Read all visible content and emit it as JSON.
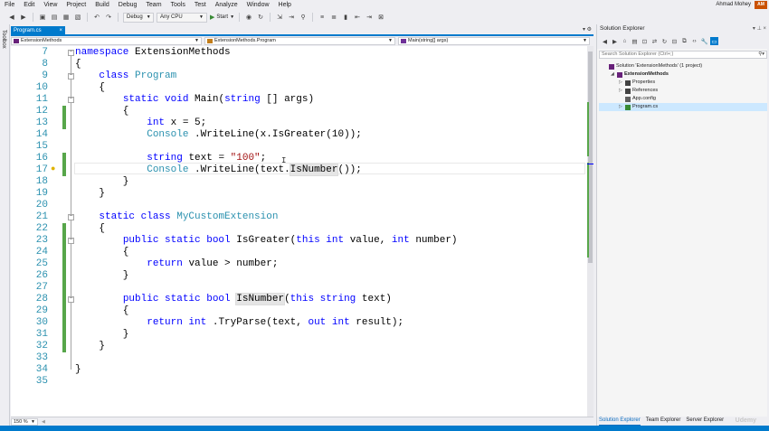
{
  "menu": [
    "File",
    "Edit",
    "View",
    "Project",
    "Build",
    "Debug",
    "Team",
    "Tools",
    "Test",
    "Analyze",
    "Window",
    "Help"
  ],
  "user": {
    "name": "Ahmad Mohey",
    "badge": "AM"
  },
  "toolbar": {
    "config": "Debug",
    "platform": "Any CPU",
    "start_label": "Start"
  },
  "toolbox_label": "Toolbox",
  "doc_tab": {
    "label": "Program.cs",
    "close": "×"
  },
  "nav": {
    "project": "ExtensionMethods",
    "type": "ExtensionMethods.Program",
    "member": "Main(string[] args)"
  },
  "editor": {
    "lines": [
      {
        "n": "7",
        "parts": [
          [
            "kw",
            "namespace"
          ],
          [
            "",
            "ExtensionMethods"
          ]
        ]
      },
      {
        "n": "8",
        "parts": [
          [
            "",
            "{"
          ]
        ]
      },
      {
        "n": "9",
        "parts": [
          [
            "",
            "    "
          ],
          [
            "kw",
            "class"
          ],
          [
            "",
            ""
          ],
          [
            "ty",
            "Program"
          ]
        ]
      },
      {
        "n": "10",
        "parts": [
          [
            "",
            "    {"
          ]
        ]
      },
      {
        "n": "11",
        "parts": [
          [
            "",
            "        "
          ],
          [
            "kw",
            "static void"
          ],
          [
            "",
            "Main("
          ],
          [
            "kw",
            "string"
          ],
          [
            "",
            "[] args)"
          ]
        ]
      },
      {
        "n": "12",
        "parts": [
          [
            "",
            "        {"
          ]
        ]
      },
      {
        "n": "13",
        "parts": [
          [
            "",
            "            "
          ],
          [
            "kw",
            "int"
          ],
          [
            "",
            "x = 5;"
          ]
        ]
      },
      {
        "n": "14",
        "parts": [
          [
            "",
            "            "
          ],
          [
            "ty",
            "Console"
          ],
          [
            "",
            ".WriteLine(x.IsGreater(10));"
          ]
        ]
      },
      {
        "n": "15",
        "parts": [
          [
            "",
            ""
          ]
        ]
      },
      {
        "n": "16",
        "parts": [
          [
            "",
            "            "
          ],
          [
            "kw",
            "string"
          ],
          [
            "",
            "text = "
          ],
          [
            "st",
            "\"100\""
          ],
          [
            "",
            ";"
          ]
        ]
      },
      {
        "n": "17",
        "parts": [
          [
            "",
            "            "
          ],
          [
            "ty",
            "Console"
          ],
          [
            "",
            ".WriteLine(text."
          ],
          [
            "hl",
            "IsNumber"
          ],
          [
            "",
            "());"
          ]
        ]
      },
      {
        "n": "18",
        "parts": [
          [
            "",
            "        }"
          ]
        ]
      },
      {
        "n": "19",
        "parts": [
          [
            "",
            "    }"
          ]
        ]
      },
      {
        "n": "20",
        "parts": [
          [
            "",
            ""
          ]
        ]
      },
      {
        "n": "21",
        "parts": [
          [
            "",
            "    "
          ],
          [
            "kw",
            "static class"
          ],
          [
            "",
            ""
          ],
          [
            "ty",
            "MyCustomExtension"
          ]
        ]
      },
      {
        "n": "22",
        "parts": [
          [
            "",
            "    {"
          ]
        ]
      },
      {
        "n": "23",
        "parts": [
          [
            "",
            "        "
          ],
          [
            "kw",
            "public static bool"
          ],
          [
            "",
            "IsGreater("
          ],
          [
            "kw",
            "this int"
          ],
          [
            "",
            "value, "
          ],
          [
            "kw",
            "int"
          ],
          [
            "",
            "number)"
          ]
        ]
      },
      {
        "n": "24",
        "parts": [
          [
            "",
            "        {"
          ]
        ]
      },
      {
        "n": "25",
        "parts": [
          [
            "",
            "            "
          ],
          [
            "kw",
            "return"
          ],
          [
            "",
            "value > number;"
          ]
        ]
      },
      {
        "n": "26",
        "parts": [
          [
            "",
            "        }"
          ]
        ]
      },
      {
        "n": "27",
        "parts": [
          [
            "",
            ""
          ]
        ]
      },
      {
        "n": "28",
        "parts": [
          [
            "",
            "        "
          ],
          [
            "kw",
            "public static bool"
          ],
          [
            "hl",
            "IsNumber"
          ],
          [
            "",
            "("
          ],
          [
            "kw",
            "this string"
          ],
          [
            "",
            "text)"
          ]
        ]
      },
      {
        "n": "29",
        "parts": [
          [
            "",
            "        {"
          ]
        ]
      },
      {
        "n": "30",
        "parts": [
          [
            "",
            "            "
          ],
          [
            "kw",
            "return int"
          ],
          [
            "",
            ".TryParse(text, "
          ],
          [
            "kw",
            "out int"
          ],
          [
            "",
            "result);"
          ]
        ]
      },
      {
        "n": "31",
        "parts": [
          [
            "",
            "        }"
          ]
        ]
      },
      {
        "n": "32",
        "parts": [
          [
            "",
            "    }"
          ]
        ]
      },
      {
        "n": "33",
        "parts": [
          [
            "",
            ""
          ]
        ]
      },
      {
        "n": "34",
        "parts": [
          [
            "",
            "}"
          ]
        ]
      },
      {
        "n": "35",
        "parts": [
          [
            "",
            ""
          ]
        ]
      }
    ]
  },
  "zoom": "150 %",
  "solution_explorer": {
    "title": "Solution Explorer",
    "search_placeholder": "Search Solution Explorer (Ctrl+;)",
    "tree": [
      {
        "label": "Solution 'ExtensionMethods' (1 project)",
        "level": 0,
        "expander": ""
      },
      {
        "label": "ExtensionMethods",
        "level": 1,
        "expander": "◢",
        "bold": true
      },
      {
        "label": "Properties",
        "level": 2,
        "expander": "▷"
      },
      {
        "label": "References",
        "level": 2,
        "expander": "▷"
      },
      {
        "label": "App.config",
        "level": 2,
        "expander": ""
      },
      {
        "label": "Program.cs",
        "level": 2,
        "expander": "▷"
      }
    ],
    "tabs": [
      "Solution Explorer",
      "Team Explorer",
      "Server Explorer"
    ]
  },
  "watermark": "Udemy",
  "colors": {
    "accent": "#007acc",
    "keyword": "#0000ff",
    "type": "#2b91af",
    "string": "#a31515",
    "change_bar": "#57a64a"
  }
}
